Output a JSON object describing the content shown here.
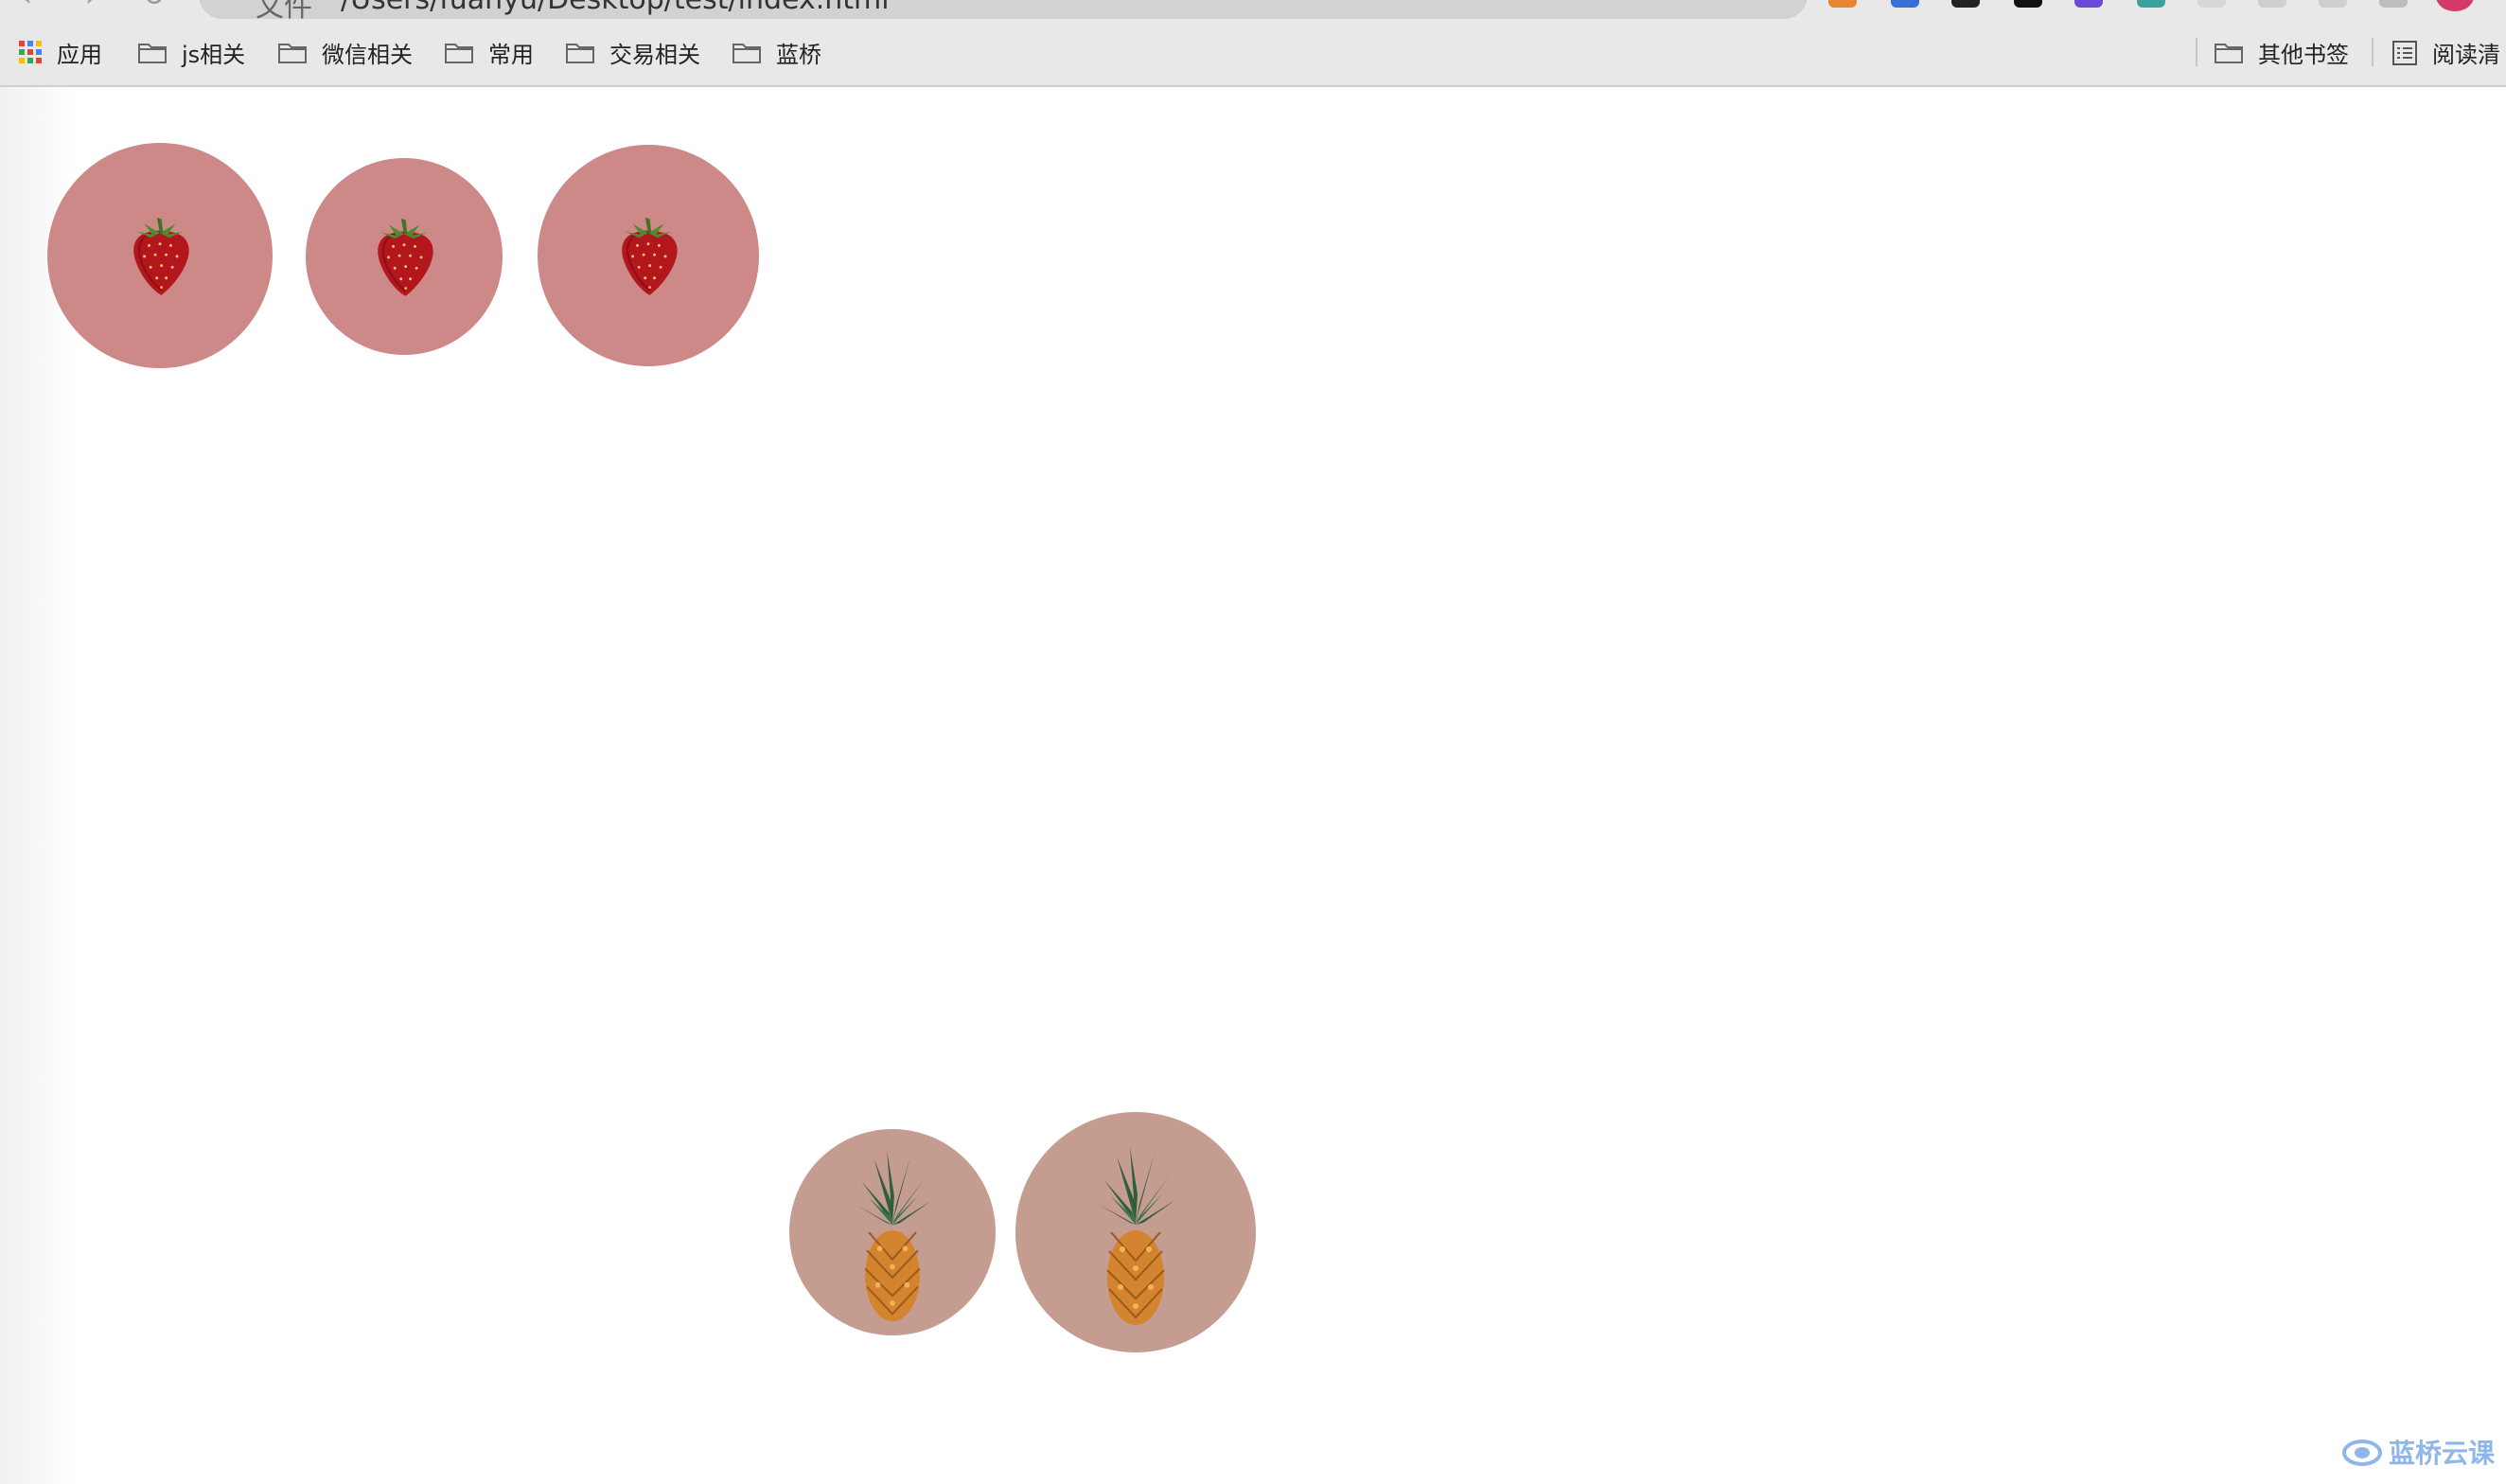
{
  "browser": {
    "address_scheme": "文件",
    "address_url": "/Users/fuanyu/Desktop/test/index.html"
  },
  "bookmarks": {
    "apps_label": "应用",
    "items": [
      "js相关",
      "微信相关",
      "常用",
      "交易相关",
      "蓝桥"
    ],
    "other_label": "其他书签",
    "reading_list_label": "阅读清"
  },
  "fruits": {
    "top_row": [
      "strawberry",
      "strawberry",
      "strawberry"
    ],
    "bottom_row": [
      "pineapple",
      "pineapple"
    ]
  },
  "colors": {
    "strawberry_circle": "#cd8888",
    "pineapple_circle": "#c49c90"
  },
  "watermark": {
    "text": "蓝桥云课"
  }
}
